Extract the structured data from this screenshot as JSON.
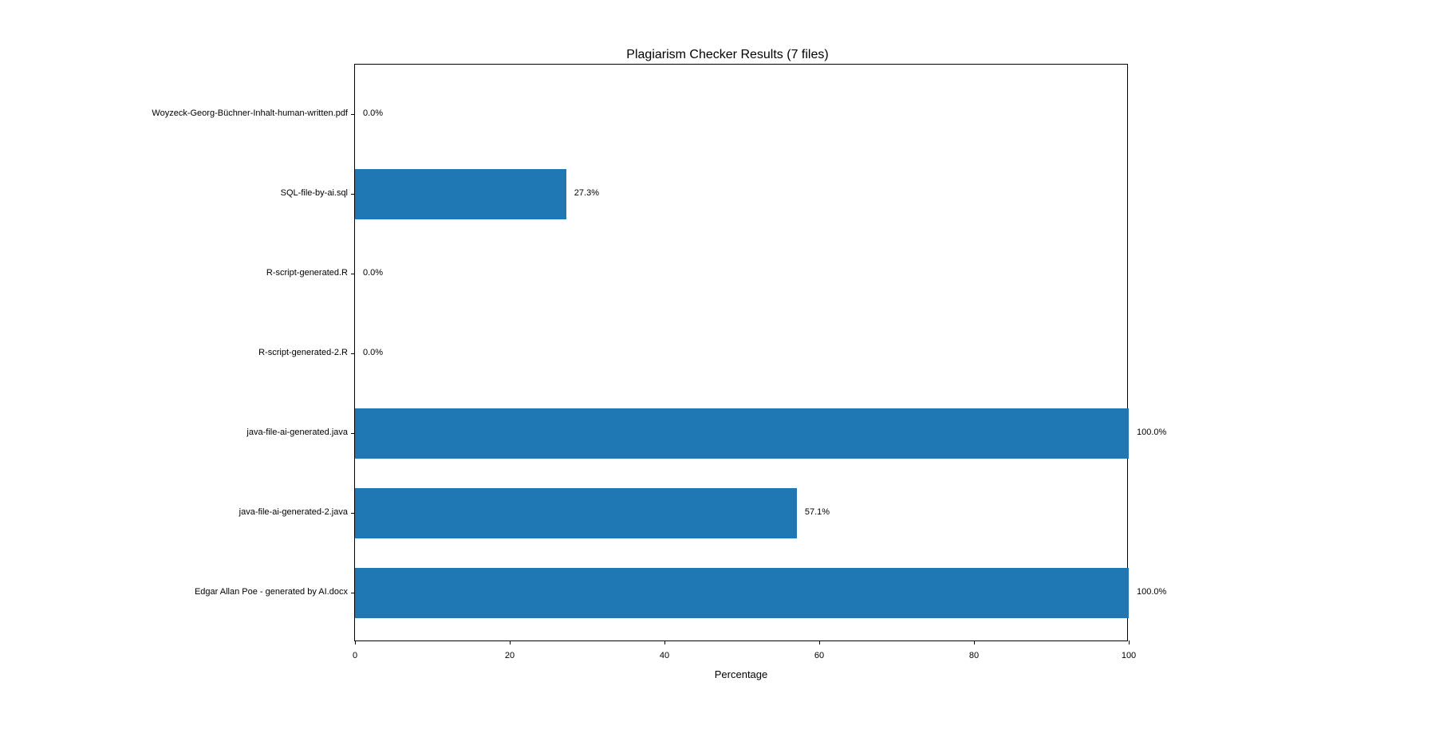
{
  "chart_data": {
    "type": "bar",
    "orientation": "horizontal",
    "title": "Plagiarism Checker Results (7 files)",
    "xlabel": "Percentage",
    "ylabel": "",
    "xlim": [
      0,
      100
    ],
    "x_ticks": [
      0,
      20,
      40,
      60,
      80,
      100
    ],
    "categories": [
      "Woyzeck-Georg-Büchner-Inhalt-human-written.pdf",
      "SQL-file-by-ai.sql",
      "R-script-generated.R",
      "R-script-generated-2.R",
      "java-file-ai-generated.java",
      "java-file-ai-generated-2.java",
      "Edgar Allan Poe - generated by AI.docx"
    ],
    "values": [
      0.0,
      27.3,
      0.0,
      0.0,
      100.0,
      57.1,
      100.0
    ],
    "value_labels": [
      "0.0%",
      "27.3%",
      "0.0%",
      "0.0%",
      "100.0%",
      "57.1%",
      "100.0%"
    ],
    "bar_color": "#1f77b4"
  }
}
